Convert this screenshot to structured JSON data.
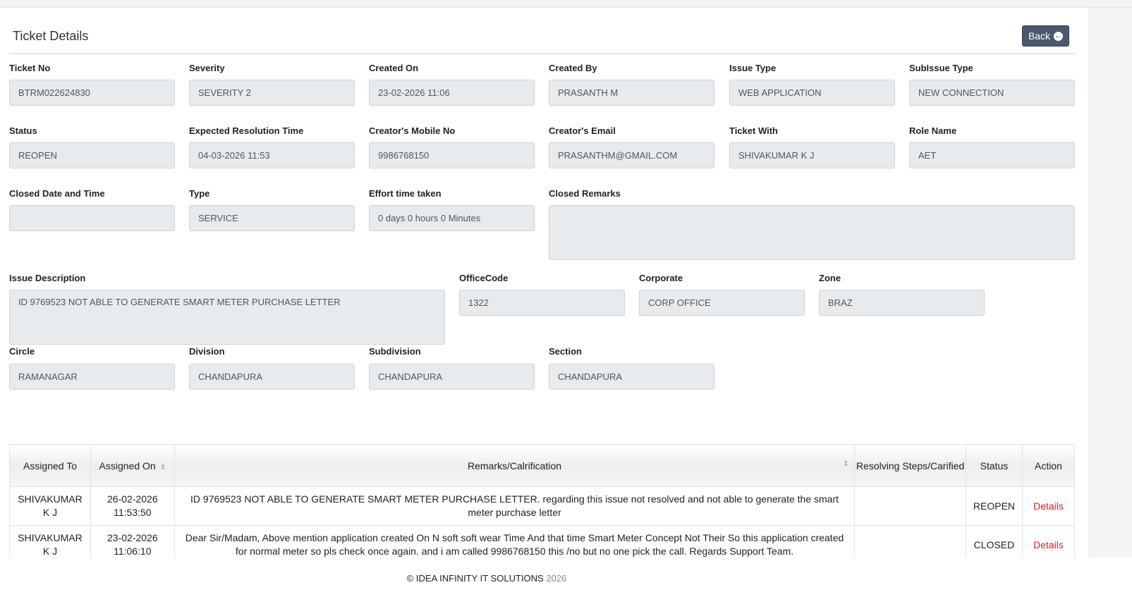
{
  "header": {
    "title": "Ticket Details",
    "back_label": "Back"
  },
  "fields": {
    "ticket_no": {
      "label": "Ticket No",
      "value": "BTRM022624830"
    },
    "severity": {
      "label": "Severity",
      "value": "SEVERITY 2"
    },
    "created_on": {
      "label": "Created On",
      "value": "23-02-2026 11:06"
    },
    "created_by": {
      "label": "Created By",
      "value": "PRASANTH M"
    },
    "issue_type": {
      "label": "Issue Type",
      "value": "WEB APPLICATION"
    },
    "subissue_type": {
      "label": "SubIssue Type",
      "value": "NEW CONNECTION"
    },
    "status": {
      "label": "Status",
      "value": "REOPEN"
    },
    "expected_resolution": {
      "label": "Expected Resolution Time",
      "value": "04-03-2026 11:53"
    },
    "mobile": {
      "label": "Creator's Mobile No",
      "value": "9986768150"
    },
    "email": {
      "label": "Creator's Email",
      "value": "PRASANTHM@GMAIL.COM"
    },
    "ticket_with": {
      "label": "Ticket With",
      "value": "SHIVAKUMAR K J"
    },
    "role_name": {
      "label": "Role Name",
      "value": "AET"
    },
    "closed_date": {
      "label": "Closed Date and Time",
      "value": ""
    },
    "type": {
      "label": "Type",
      "value": "SERVICE"
    },
    "effort": {
      "label": "Effort time taken",
      "value": "0 days 0 hours 0 Minutes"
    },
    "closed_remarks": {
      "label": "Closed Remarks",
      "value": ""
    },
    "issue_description": {
      "label": "Issue Description",
      "value": "ID 9769523 NOT ABLE TO GENERATE SMART METER PURCHASE LETTER"
    },
    "office_code": {
      "label": "OfficeCode",
      "value": "1322"
    },
    "corporate": {
      "label": "Corporate",
      "value": "CORP OFFICE"
    },
    "zone": {
      "label": "Zone",
      "value": "BRAZ"
    },
    "circle": {
      "label": "Circle",
      "value": "RAMANAGAR"
    },
    "division": {
      "label": "Division",
      "value": "CHANDAPURA"
    },
    "subdivision": {
      "label": "Subdivision",
      "value": "CHANDAPURA"
    },
    "section": {
      "label": "Section",
      "value": "CHANDAPURA"
    }
  },
  "table": {
    "headers": [
      "Assigned To",
      "Assigned On",
      "Remarks/Calrification",
      "Resolving Steps/Carified",
      "Status",
      "Action"
    ],
    "rows": [
      {
        "assigned_to": "SHIVAKUMAR K J",
        "assigned_on": "26-02-2026 11:53:50",
        "remarks": "ID 9769523 NOT ABLE TO GENERATE SMART METER PURCHASE LETTER. regarding this issue not resolved and not able to generate the smart meter purchase letter",
        "steps": "",
        "status": "REOPEN",
        "action": "Details"
      },
      {
        "assigned_to": "SHIVAKUMAR K J",
        "assigned_on": "23-02-2026 11:06:10",
        "remarks": "Dear Sir/Madam, Above mention application created On N soft soft wear Time And that time Smart Meter Concept Not Their So this application created for normal meter so pls check once again. and i am called 9986768150 this /no but no one pick the call. Regards Support Team.",
        "steps": "",
        "status": "CLOSED",
        "action": "Details"
      }
    ]
  },
  "footer": {
    "text": "© IDEA INFINITY IT SOLUTIONS",
    "year": "2026"
  }
}
